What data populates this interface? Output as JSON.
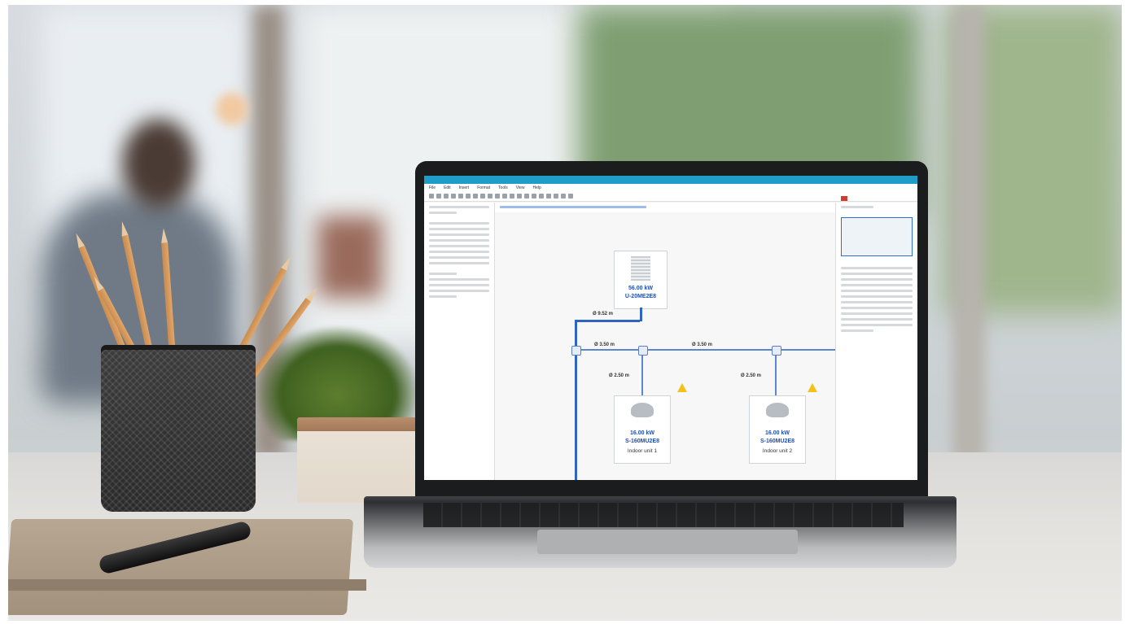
{
  "scene": {
    "description_objects": [
      "laptop",
      "pencil-cup",
      "potted-plant",
      "notebook",
      "pen"
    ]
  },
  "app": {
    "menu": [
      "File",
      "Edit",
      "Insert",
      "Format",
      "Tools",
      "View",
      "Help"
    ],
    "diagram": {
      "outdoor_unit": {
        "capacity": "56.00 kW",
        "model": "U-20ME2E8"
      },
      "pipe_labels": [
        "Ø 9.52 m",
        "Ø 3.50 m",
        "Ø 3.50 m",
        "Ø 2.50 m",
        "Ø 2.50 m"
      ],
      "indoor_units": [
        {
          "capacity": "16.00 kW",
          "model": "S-160MU2E8",
          "name": "Indoor unit 1"
        },
        {
          "capacity": "16.00 kW",
          "model": "S-160MU2E8",
          "name": "Indoor unit 2"
        }
      ]
    }
  },
  "colors": {
    "titlebar": "#1f9cc7",
    "pipe": "#5b86d2",
    "label_blue": "#1e4fb5",
    "warning": "#f2c21a"
  }
}
